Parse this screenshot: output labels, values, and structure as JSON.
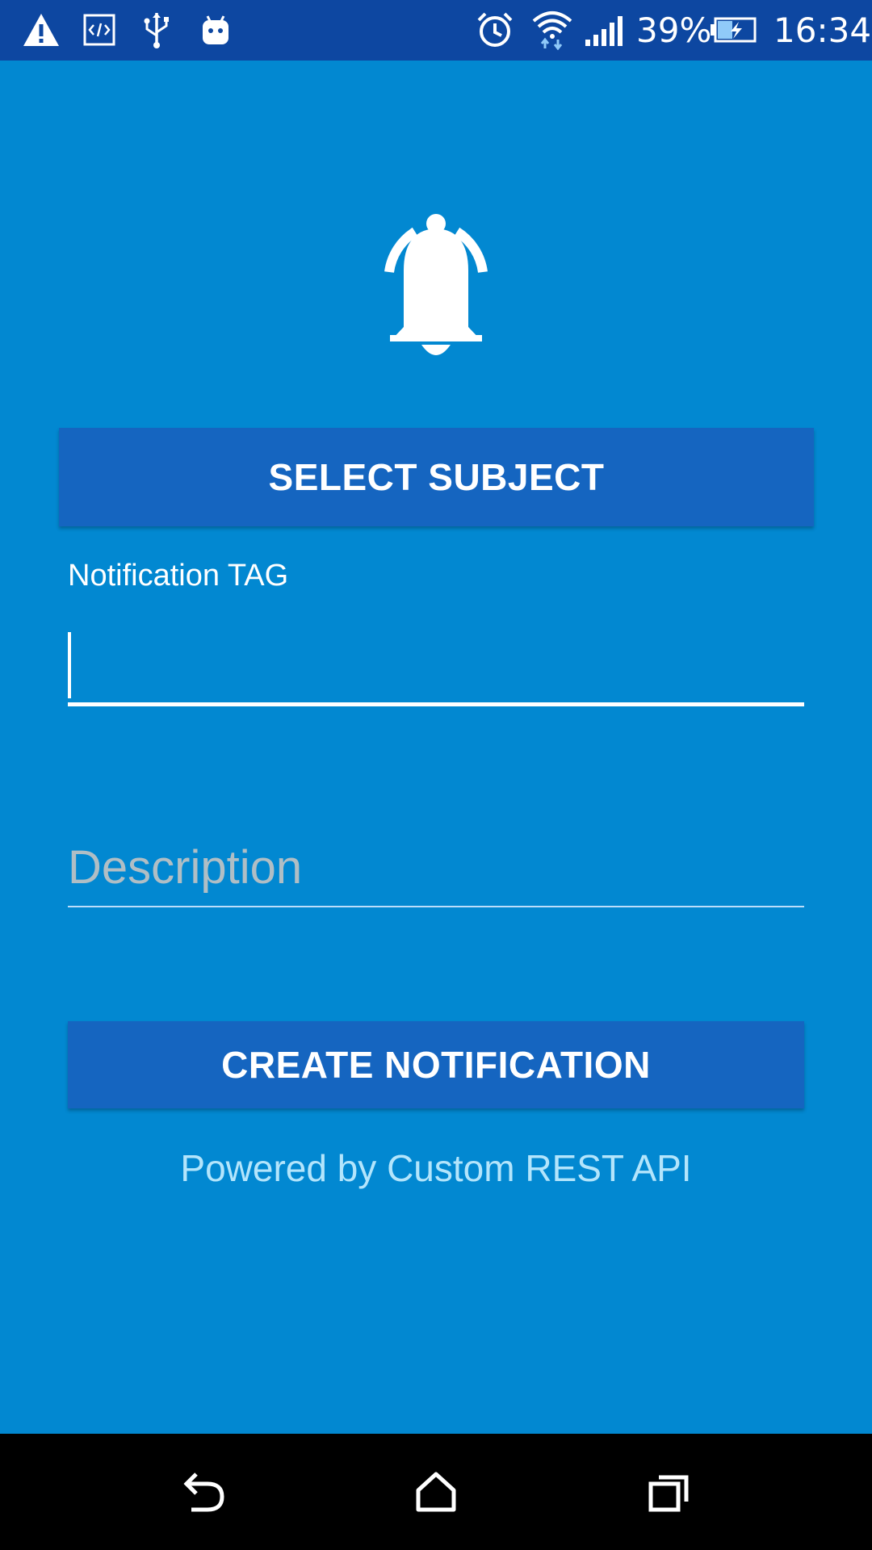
{
  "status_bar": {
    "battery_percent": "39%",
    "time": "16:34",
    "icons": [
      "warning-icon",
      "code-icon",
      "usb-icon",
      "android-icon",
      "alarm-icon",
      "wifi-icon",
      "signal-icon",
      "battery-charging-icon"
    ]
  },
  "header_icon": "bell-icon",
  "select_subject_label": "SELECT SUBJECT",
  "tag_field": {
    "label": "Notification TAG",
    "value": ""
  },
  "description_field": {
    "placeholder": "Description",
    "value": ""
  },
  "create_button_label": "CREATE NOTIFICATION",
  "footer_text": "Powered by Custom REST API",
  "nav_bar": {
    "icons": [
      "back-icon",
      "home-icon",
      "recents-icon"
    ]
  },
  "colors": {
    "background": "#0288D1",
    "status_bar": "#0D47A1",
    "button": "#1565C0",
    "nav_bar": "#000000"
  }
}
